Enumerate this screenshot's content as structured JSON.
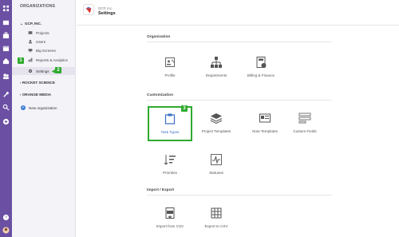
{
  "orgs_panel": {
    "header": "ORGANIZATIONS",
    "gcp": "GCP, INC.",
    "items": [
      {
        "label": "Projects"
      },
      {
        "label": "Users"
      },
      {
        "label": "Big Screens"
      },
      {
        "label": "Reports & Analytics"
      },
      {
        "label": "Settings"
      }
    ],
    "rocket": "ROCKET SCIENCE",
    "orange": "ORANGE MEDIA",
    "new_org": "New organization"
  },
  "header": {
    "org": "GCP, Inc.",
    "title": "Settings"
  },
  "sections": {
    "organization": {
      "title": "Organization",
      "tiles": [
        {
          "label": "Profile"
        },
        {
          "label": "Departments"
        },
        {
          "label": "Billing & Finance"
        }
      ]
    },
    "customization": {
      "title": "Customization",
      "tiles": [
        {
          "label": "Task Types"
        },
        {
          "label": "Project Templates"
        },
        {
          "label": "Note Templates"
        },
        {
          "label": "Custom Fields"
        },
        {
          "label": "Priorities"
        },
        {
          "label": "Statuses"
        }
      ]
    },
    "import_export": {
      "title": "Import / Export",
      "tiles": [
        {
          "label": "Import from CSV"
        },
        {
          "label": "Export to CSV"
        }
      ]
    }
  },
  "badges": {
    "one": "1",
    "two": "2",
    "three": "3"
  },
  "colors": {
    "rail": "#6a4fa3",
    "accent": "#2faa2f",
    "link": "#3a6fc5"
  }
}
